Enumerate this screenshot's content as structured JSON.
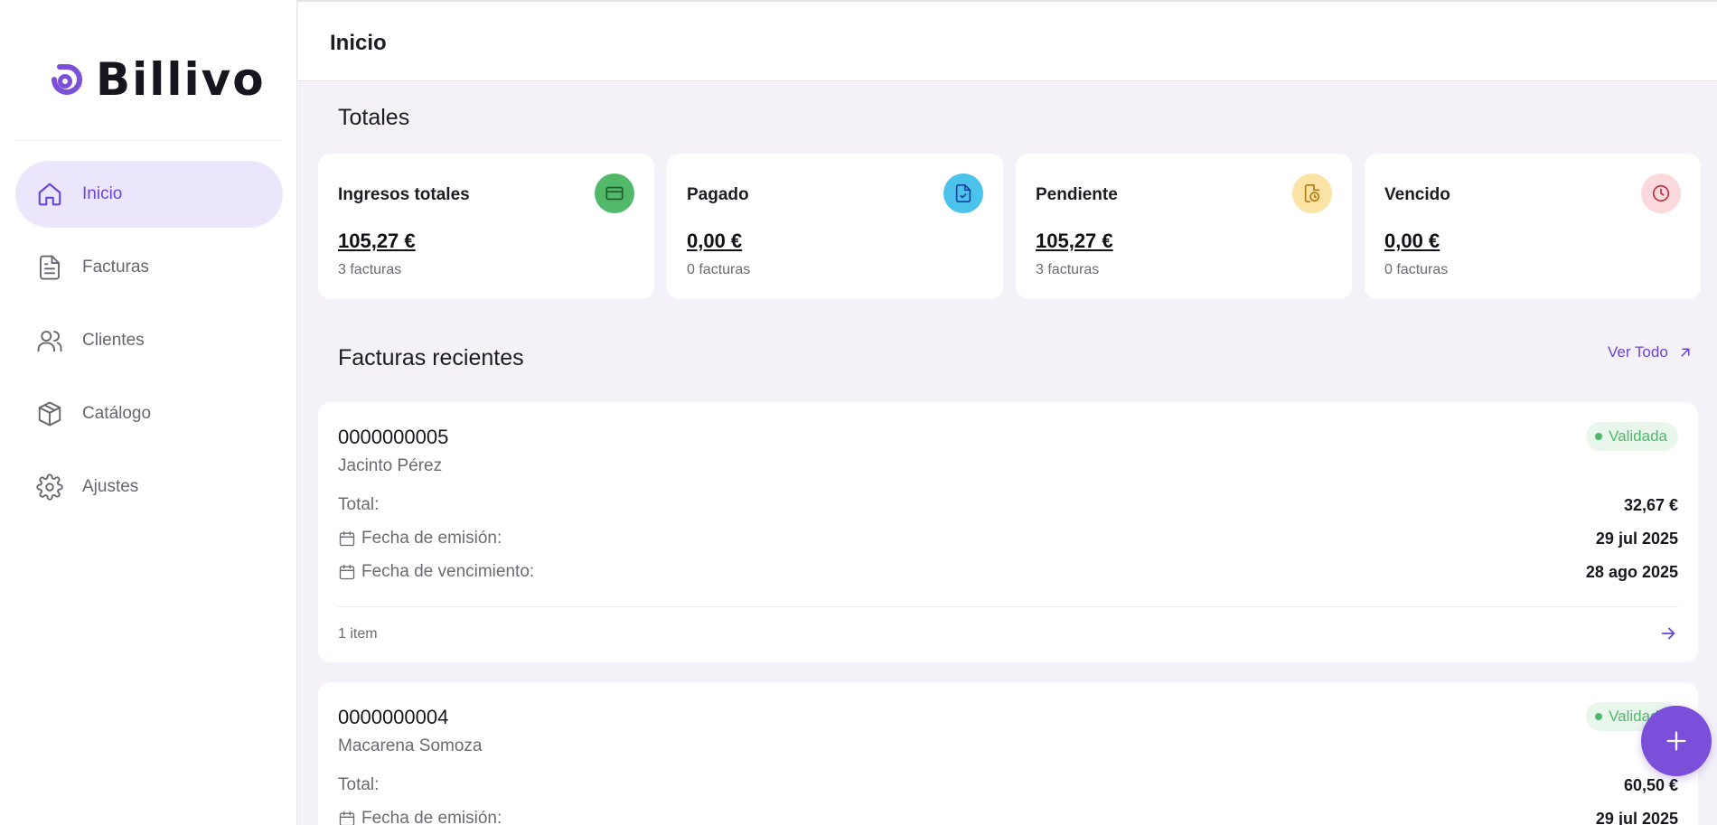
{
  "brand": {
    "name": "Billivo",
    "accent": "#7b4fd9"
  },
  "header": {
    "title": "Inicio"
  },
  "sidebar": {
    "items": [
      {
        "label": "Inicio",
        "icon": "home-icon",
        "active": true
      },
      {
        "label": "Facturas",
        "icon": "file-text-icon",
        "active": false
      },
      {
        "label": "Clientes",
        "icon": "users-icon",
        "active": false
      },
      {
        "label": "Catálogo",
        "icon": "box-icon",
        "active": false
      },
      {
        "label": "Ajustes",
        "icon": "gear-icon",
        "active": false
      }
    ]
  },
  "totals": {
    "title": "Totales",
    "cards": [
      {
        "title": "Ingresos totales",
        "amount": "105,27 €",
        "sub": "3 facturas",
        "icon": "credit-card-icon",
        "color": "#52b96a"
      },
      {
        "title": "Pagado",
        "amount": "0,00 €",
        "sub": "0 facturas",
        "icon": "file-check-icon",
        "color": "#4cc3ea"
      },
      {
        "title": "Pendiente",
        "amount": "105,27 €",
        "sub": "3 facturas",
        "icon": "file-clock-icon",
        "color": "#fbe3a5"
      },
      {
        "title": "Vencido",
        "amount": "0,00 €",
        "sub": "0 facturas",
        "icon": "clock-icon",
        "color": "#fbd9dc"
      }
    ]
  },
  "recent": {
    "title": "Facturas recientes",
    "see_all": "Ver Todo",
    "invoices": [
      {
        "number": "0000000005",
        "client": "Jacinto Pérez",
        "status": "Validada",
        "total_label": "Total:",
        "total": "32,67 €",
        "issue_label": "Fecha de emisión:",
        "issue_date": "29 jul 2025",
        "due_label": "Fecha de vencimiento:",
        "due_date": "28 ago 2025",
        "items": "1 item"
      },
      {
        "number": "0000000004",
        "client": "Macarena Somoza",
        "status": "Validada",
        "total_label": "Total:",
        "total": "60,50 €",
        "issue_label": "Fecha de emisión:",
        "issue_date": "29 jul 2025"
      }
    ]
  }
}
